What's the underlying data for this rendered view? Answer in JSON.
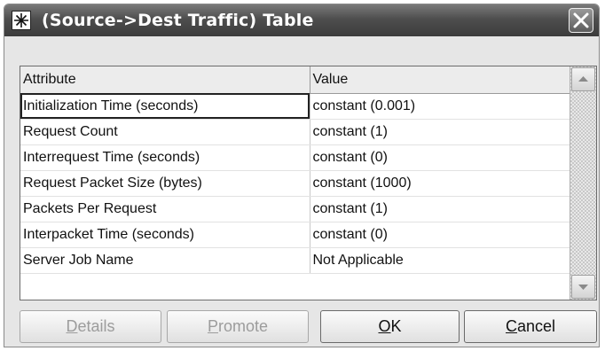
{
  "window": {
    "title": "(Source->Dest Traffic) Table"
  },
  "table": {
    "columns": [
      "Attribute",
      "Value"
    ],
    "rows": [
      {
        "attribute": "Initialization Time (seconds)",
        "value": "constant (0.001)"
      },
      {
        "attribute": "Request Count",
        "value": "constant (1)"
      },
      {
        "attribute": "Interrequest Time (seconds)",
        "value": "constant (0)"
      },
      {
        "attribute": "Request Packet Size (bytes)",
        "value": "constant (1000)"
      },
      {
        "attribute": "Packets Per Request",
        "value": "constant (1)"
      },
      {
        "attribute": "Interpacket Time (seconds)",
        "value": "constant (0)"
      },
      {
        "attribute": "Server Job Name",
        "value": "Not Applicable"
      }
    ],
    "selected_row": 0
  },
  "buttons": {
    "details": {
      "mnemonic": "D",
      "rest": "etails",
      "enabled": false
    },
    "promote": {
      "mnemonic": "P",
      "rest": "romote",
      "enabled": false
    },
    "ok": {
      "mnemonic": "O",
      "rest": "K",
      "enabled": true
    },
    "cancel": {
      "mnemonic": "C",
      "rest": "ancel",
      "enabled": true
    }
  },
  "icons": {
    "app": "star-burst-icon",
    "close": "close-icon",
    "scroll_up": "scroll-up-arrow-icon",
    "scroll_down": "scroll-down-arrow-icon"
  }
}
